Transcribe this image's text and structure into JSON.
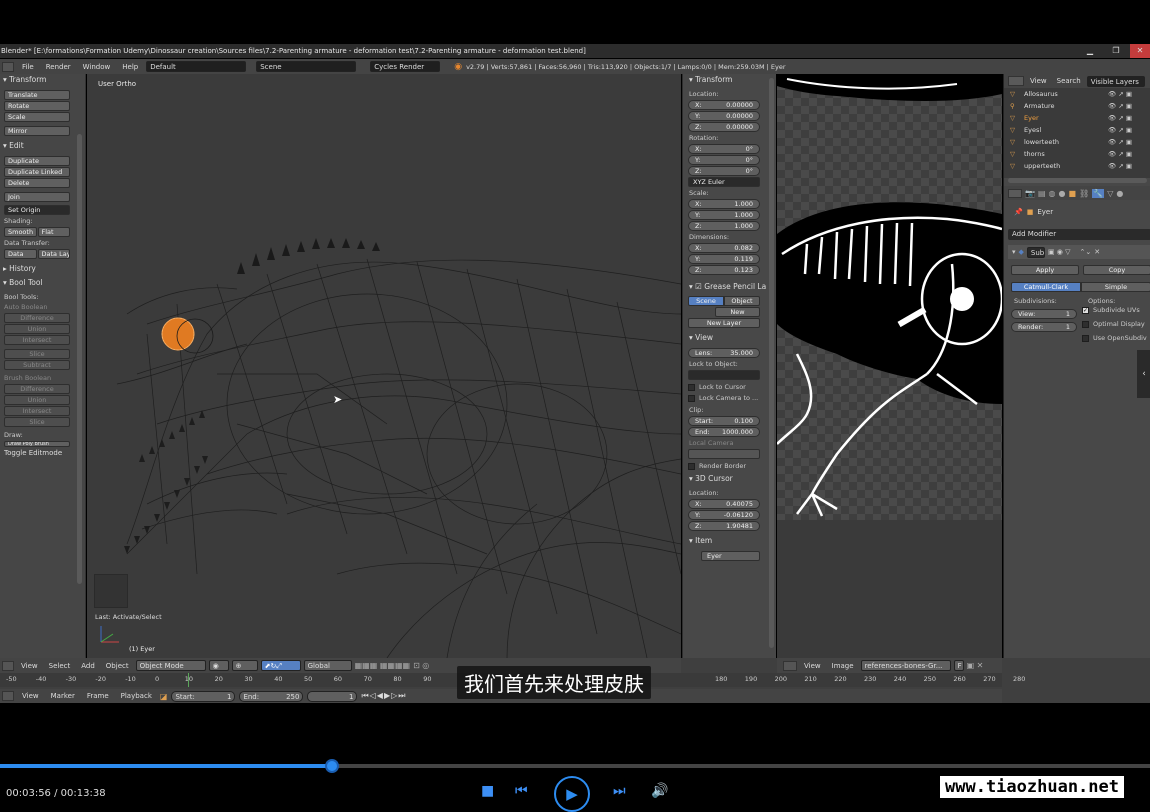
{
  "window": {
    "title": "Blender* [E:\\formations\\Formation Udemy\\Dinossaur creation\\Sources files\\7.2-Parenting armature - deformation test\\7.2-Parenting armature - deformation test.blend]"
  },
  "menubar": {
    "items": [
      "File",
      "Render",
      "Window",
      "Help"
    ],
    "layout": "Default",
    "scene": "Scene",
    "engine": "Cycles Render",
    "stats": "v2.79 | Verts:57,861 | Faces:56,960 | Tris:113,920 | Objects:1/7 | Lamps:0/0 | Mem:259.03M | Eyer"
  },
  "toolshelf": {
    "transform": {
      "header": "Transform",
      "buttons": [
        "Translate",
        "Rotate",
        "Scale",
        "Mirror"
      ]
    },
    "edit": {
      "header": "Edit",
      "buttons": [
        "Duplicate",
        "Duplicate Linked",
        "Delete",
        "Join"
      ],
      "set_origin": "Set Origin",
      "shading_label": "Shading:",
      "smooth": "Smooth",
      "flat": "Flat",
      "data_transfer_label": "Data Transfer:",
      "data": "Data",
      "data_lay": "Data Lay"
    },
    "history": "History",
    "bool": {
      "header": "Bool Tool",
      "label": "Bool Tools:",
      "auto_label": "Auto Boolean",
      "auto": [
        "Difference",
        "Union",
        "Intersect",
        "Slice",
        "Subtract"
      ],
      "brush_label": "Brush Boolean",
      "brush": [
        "Difference",
        "Union",
        "Intersect",
        "Slice"
      ],
      "draw_label": "Draw:",
      "draw_btn": "Draw Poly Brush"
    },
    "toggle": "Toggle Editmode"
  },
  "viewport": {
    "view_label": "User Ortho",
    "last_op": "Last: Activate/Select",
    "object_label": "(1) Eyer"
  },
  "npanel": {
    "transform": "Transform",
    "location_label": "Location:",
    "location": [
      {
        "k": "X:",
        "v": "0.00000"
      },
      {
        "k": "Y:",
        "v": "0.00000"
      },
      {
        "k": "Z:",
        "v": "0.00000"
      }
    ],
    "rotation_label": "Rotation:",
    "rotation": [
      {
        "k": "X:",
        "v": "0°"
      },
      {
        "k": "Y:",
        "v": "0°"
      },
      {
        "k": "Z:",
        "v": "0°"
      }
    ],
    "rot_mode": "XYZ Euler",
    "scale_label": "Scale:",
    "scale": [
      {
        "k": "X:",
        "v": "1.000"
      },
      {
        "k": "Y:",
        "v": "1.000"
      },
      {
        "k": "Z:",
        "v": "1.000"
      }
    ],
    "dimensions_label": "Dimensions:",
    "dimensions": [
      {
        "k": "X:",
        "v": "0.082"
      },
      {
        "k": "Y:",
        "v": "0.119"
      },
      {
        "k": "Z:",
        "v": "0.123"
      }
    ],
    "grease": "Grease Pencil La",
    "gp_scene": "Scene",
    "gp_object": "Object",
    "gp_new": "New",
    "gp_newlayer": "New Layer",
    "view": "View",
    "lens_k": "Lens:",
    "lens_v": "35.000",
    "lock_label": "Lock to Object:",
    "lock_cursor": "Lock to Cursor",
    "lock_camera": "Lock Camera to ...",
    "clip_label": "Clip:",
    "clip_start_k": "Start:",
    "clip_start_v": "0.100",
    "clip_end_k": "End:",
    "clip_end_v": "1000.000",
    "local_camera": "Local Camera",
    "render_border": "Render Border",
    "cursor": "3D Cursor",
    "cursor_loc_label": "Location:",
    "cursor_loc": [
      {
        "k": "X:",
        "v": "0.40075"
      },
      {
        "k": "Y:",
        "v": "-0.06120"
      },
      {
        "k": "Z:",
        "v": "1.90481"
      }
    ],
    "item": "Item",
    "item_name": "Eyer"
  },
  "outliner": {
    "tabs": [
      "View",
      "Search",
      "Visible Layers"
    ],
    "items": [
      "Allosaurus",
      "Armature",
      "Eyer",
      "Eyesl",
      "lowerteeth",
      "thorns",
      "upperteeth"
    ]
  },
  "properties": {
    "breadcrumb": "Eyer",
    "add_modifier": "Add Modifier",
    "mod_name": "Sub",
    "apply": "Apply",
    "copy": "Copy",
    "catmull": "Catmull-Clark",
    "simple": "Simple",
    "subdivisions": "Subdivisions:",
    "options": "Options:",
    "view_k": "View:",
    "view_v": "1",
    "render_k": "Render:",
    "render_v": "1",
    "subdivide_uvs": "Subdivide UVs",
    "optimal_display": "Optimal Display",
    "use_opensubdiv": "Use OpenSubdiv"
  },
  "header3d": {
    "items": [
      "View",
      "Select",
      "Add",
      "Object"
    ],
    "mode": "Object Mode",
    "orientation": "Global"
  },
  "imgheader": {
    "items": [
      "View",
      "Image"
    ],
    "image": "references-bones-Gr...",
    "f": "F"
  },
  "timeline": {
    "ticks_left": [
      "-50",
      "-40",
      "-30",
      "-20",
      "-10",
      "0",
      "10",
      "20",
      "30",
      "40",
      "50",
      "60",
      "70",
      "80",
      "90"
    ],
    "ticks_right": [
      "180",
      "190",
      "200",
      "210",
      "220",
      "230",
      "240",
      "250",
      "260",
      "270",
      "280"
    ],
    "items": [
      "View",
      "Marker",
      "Frame",
      "Playback"
    ],
    "start_k": "Start:",
    "start_v": "1",
    "end_k": "End:",
    "end_v": "250",
    "current": "1"
  },
  "subtitle": "我们首先来处理皮肤",
  "player": {
    "time": "00:03:56 / 00:13:38",
    "progress": 0.2885,
    "watermark": "www.tiaozhuan.net"
  }
}
